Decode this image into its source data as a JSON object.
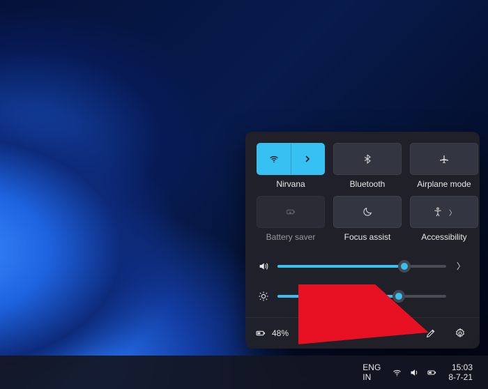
{
  "colors": {
    "accent": "#37c0f2",
    "panel": "#202128",
    "tile": "#333540"
  },
  "quick_settings": {
    "tiles": [
      {
        "id": "wifi",
        "label": "Nirvana",
        "active": true,
        "split": true
      },
      {
        "id": "bluetooth",
        "label": "Bluetooth",
        "active": false,
        "split": false
      },
      {
        "id": "airplane",
        "label": "Airplane mode",
        "active": false,
        "split": false
      },
      {
        "id": "battery-saver",
        "label": "Battery saver",
        "active": false,
        "split": false,
        "disabled": true
      },
      {
        "id": "focus-assist",
        "label": "Focus assist",
        "active": false,
        "split": false
      },
      {
        "id": "accessibility",
        "label": "Accessibility",
        "active": false,
        "split": true
      }
    ],
    "sliders": {
      "volume": {
        "value": 75,
        "has_expand": true
      },
      "brightness": {
        "value": 72,
        "has_expand": false
      }
    },
    "footer": {
      "battery_percent": "48%"
    }
  },
  "taskbar": {
    "lang_primary": "ENG",
    "lang_secondary": "IN",
    "time": "15:03",
    "date": "8-7-21"
  }
}
